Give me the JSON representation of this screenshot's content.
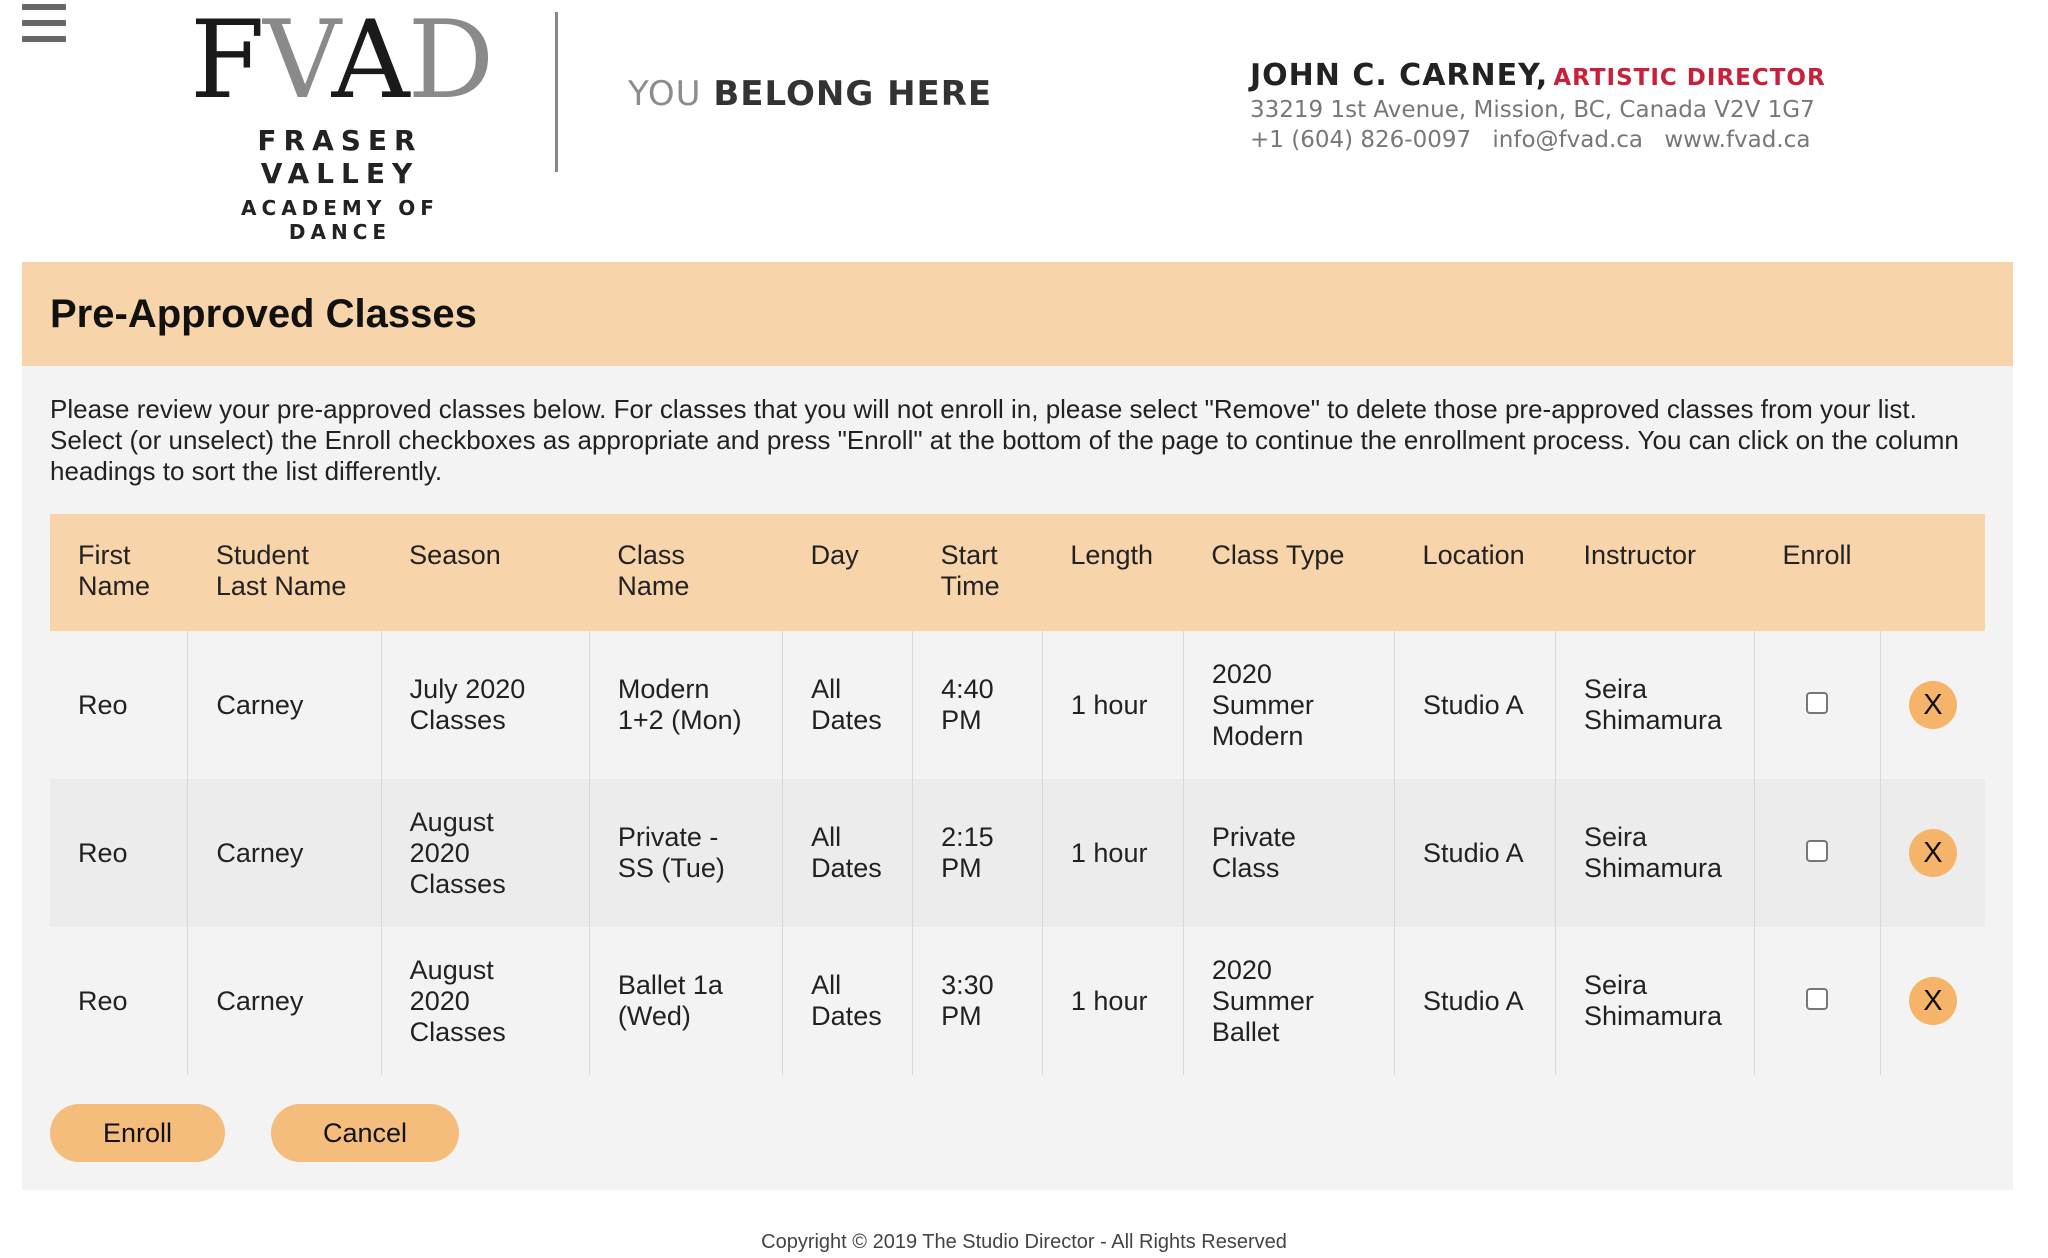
{
  "header": {
    "menu_icon": "hamburger-menu-icon",
    "logo": {
      "mark_dark1": "F",
      "mark_light1": "V",
      "mark_dark2": "A",
      "mark_light2": "D",
      "line1": "FRASER VALLEY",
      "line2": "ACADEMY OF DANCE"
    },
    "tagline_part1": "YOU",
    "tagline_part2": "BELONG HERE",
    "contact": {
      "name": "JOHN C. CARNEY,",
      "role": "ARTISTIC DIRECTOR",
      "address": "33219 1st Avenue, Mission, BC, Canada V2V 1G7",
      "phone": "+1 (604) 826-0097",
      "email": "info@fvad.ca",
      "website": "www.fvad.ca"
    },
    "colors": {
      "accent_red": "#c8203a"
    }
  },
  "panel": {
    "title": "Pre-Approved Classes",
    "intro": "Please review your pre-approved classes below. For classes that you will not enroll in, please select \"Remove\" to delete those pre-approved classes from your list. Select (or unselect) the Enroll checkboxes as appropriate and press \"Enroll\" at the bottom of the page to continue the enrollment process. You can click on the column headings to sort the list differently.",
    "colors": {
      "header_bg": "#f7d4a9",
      "button_bg": "#f5bd7c",
      "remove_bg": "#f5b46a"
    }
  },
  "table": {
    "columns": [
      "First Name",
      "Student Last Name",
      "Season",
      "Class Name",
      "Day",
      "Start Time",
      "Length",
      "Class Type",
      "Location",
      "Instructor",
      "Enroll"
    ],
    "rows": [
      {
        "first": "Reo",
        "last": "Carney",
        "season": "July 2020 Classes",
        "class_name": "Modern 1+2 (Mon)",
        "day": "All Dates",
        "start": "4:40 PM",
        "length": "1 hour",
        "class_type": "2020 Summer Modern",
        "location": "Studio A",
        "instructor": "Seira Shimamura",
        "enrolled": false,
        "remove_label": "X"
      },
      {
        "first": "Reo",
        "last": "Carney",
        "season": "August 2020 Classes",
        "class_name": "Private - SS (Tue)",
        "day": "All Dates",
        "start": "2:15 PM",
        "length": "1 hour",
        "class_type": "Private Class",
        "location": "Studio A",
        "instructor": "Seira Shimamura",
        "enrolled": false,
        "remove_label": "X"
      },
      {
        "first": "Reo",
        "last": "Carney",
        "season": "August 2020 Classes",
        "class_name": "Ballet 1a (Wed)",
        "day": "All Dates",
        "start": "3:30 PM",
        "length": "1 hour",
        "class_type": "2020 Summer Ballet",
        "location": "Studio A",
        "instructor": "Seira Shimamura",
        "enrolled": false,
        "remove_label": "X"
      }
    ]
  },
  "buttons": {
    "enroll": "Enroll",
    "cancel": "Cancel"
  },
  "footer": {
    "copyright": "Copyright © 2019 The Studio Director - All Rights Reserved"
  }
}
